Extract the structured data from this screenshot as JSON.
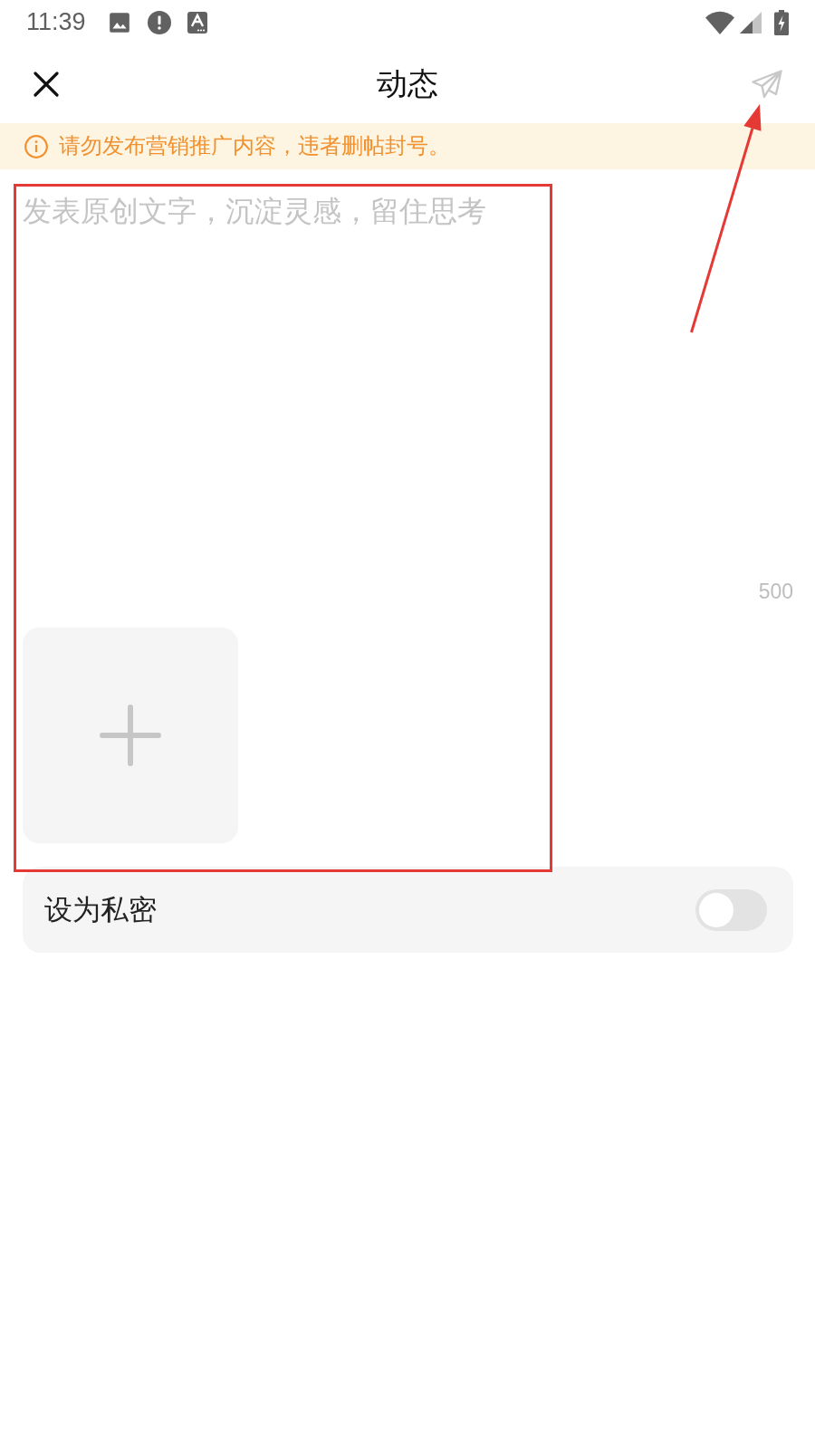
{
  "status_bar": {
    "time": "11:39"
  },
  "header": {
    "title": "动态",
    "send_button": {
      "disabled": true,
      "arrow_marked": true
    }
  },
  "notice": {
    "text": "请勿发布营销推广内容，违者删帖封号。"
  },
  "composer": {
    "placeholder": "发表原创文字，沉淀灵感，留住思考",
    "counter": "500",
    "highlighted": true
  },
  "privacy": {
    "label": "设为私密",
    "on": false
  }
}
